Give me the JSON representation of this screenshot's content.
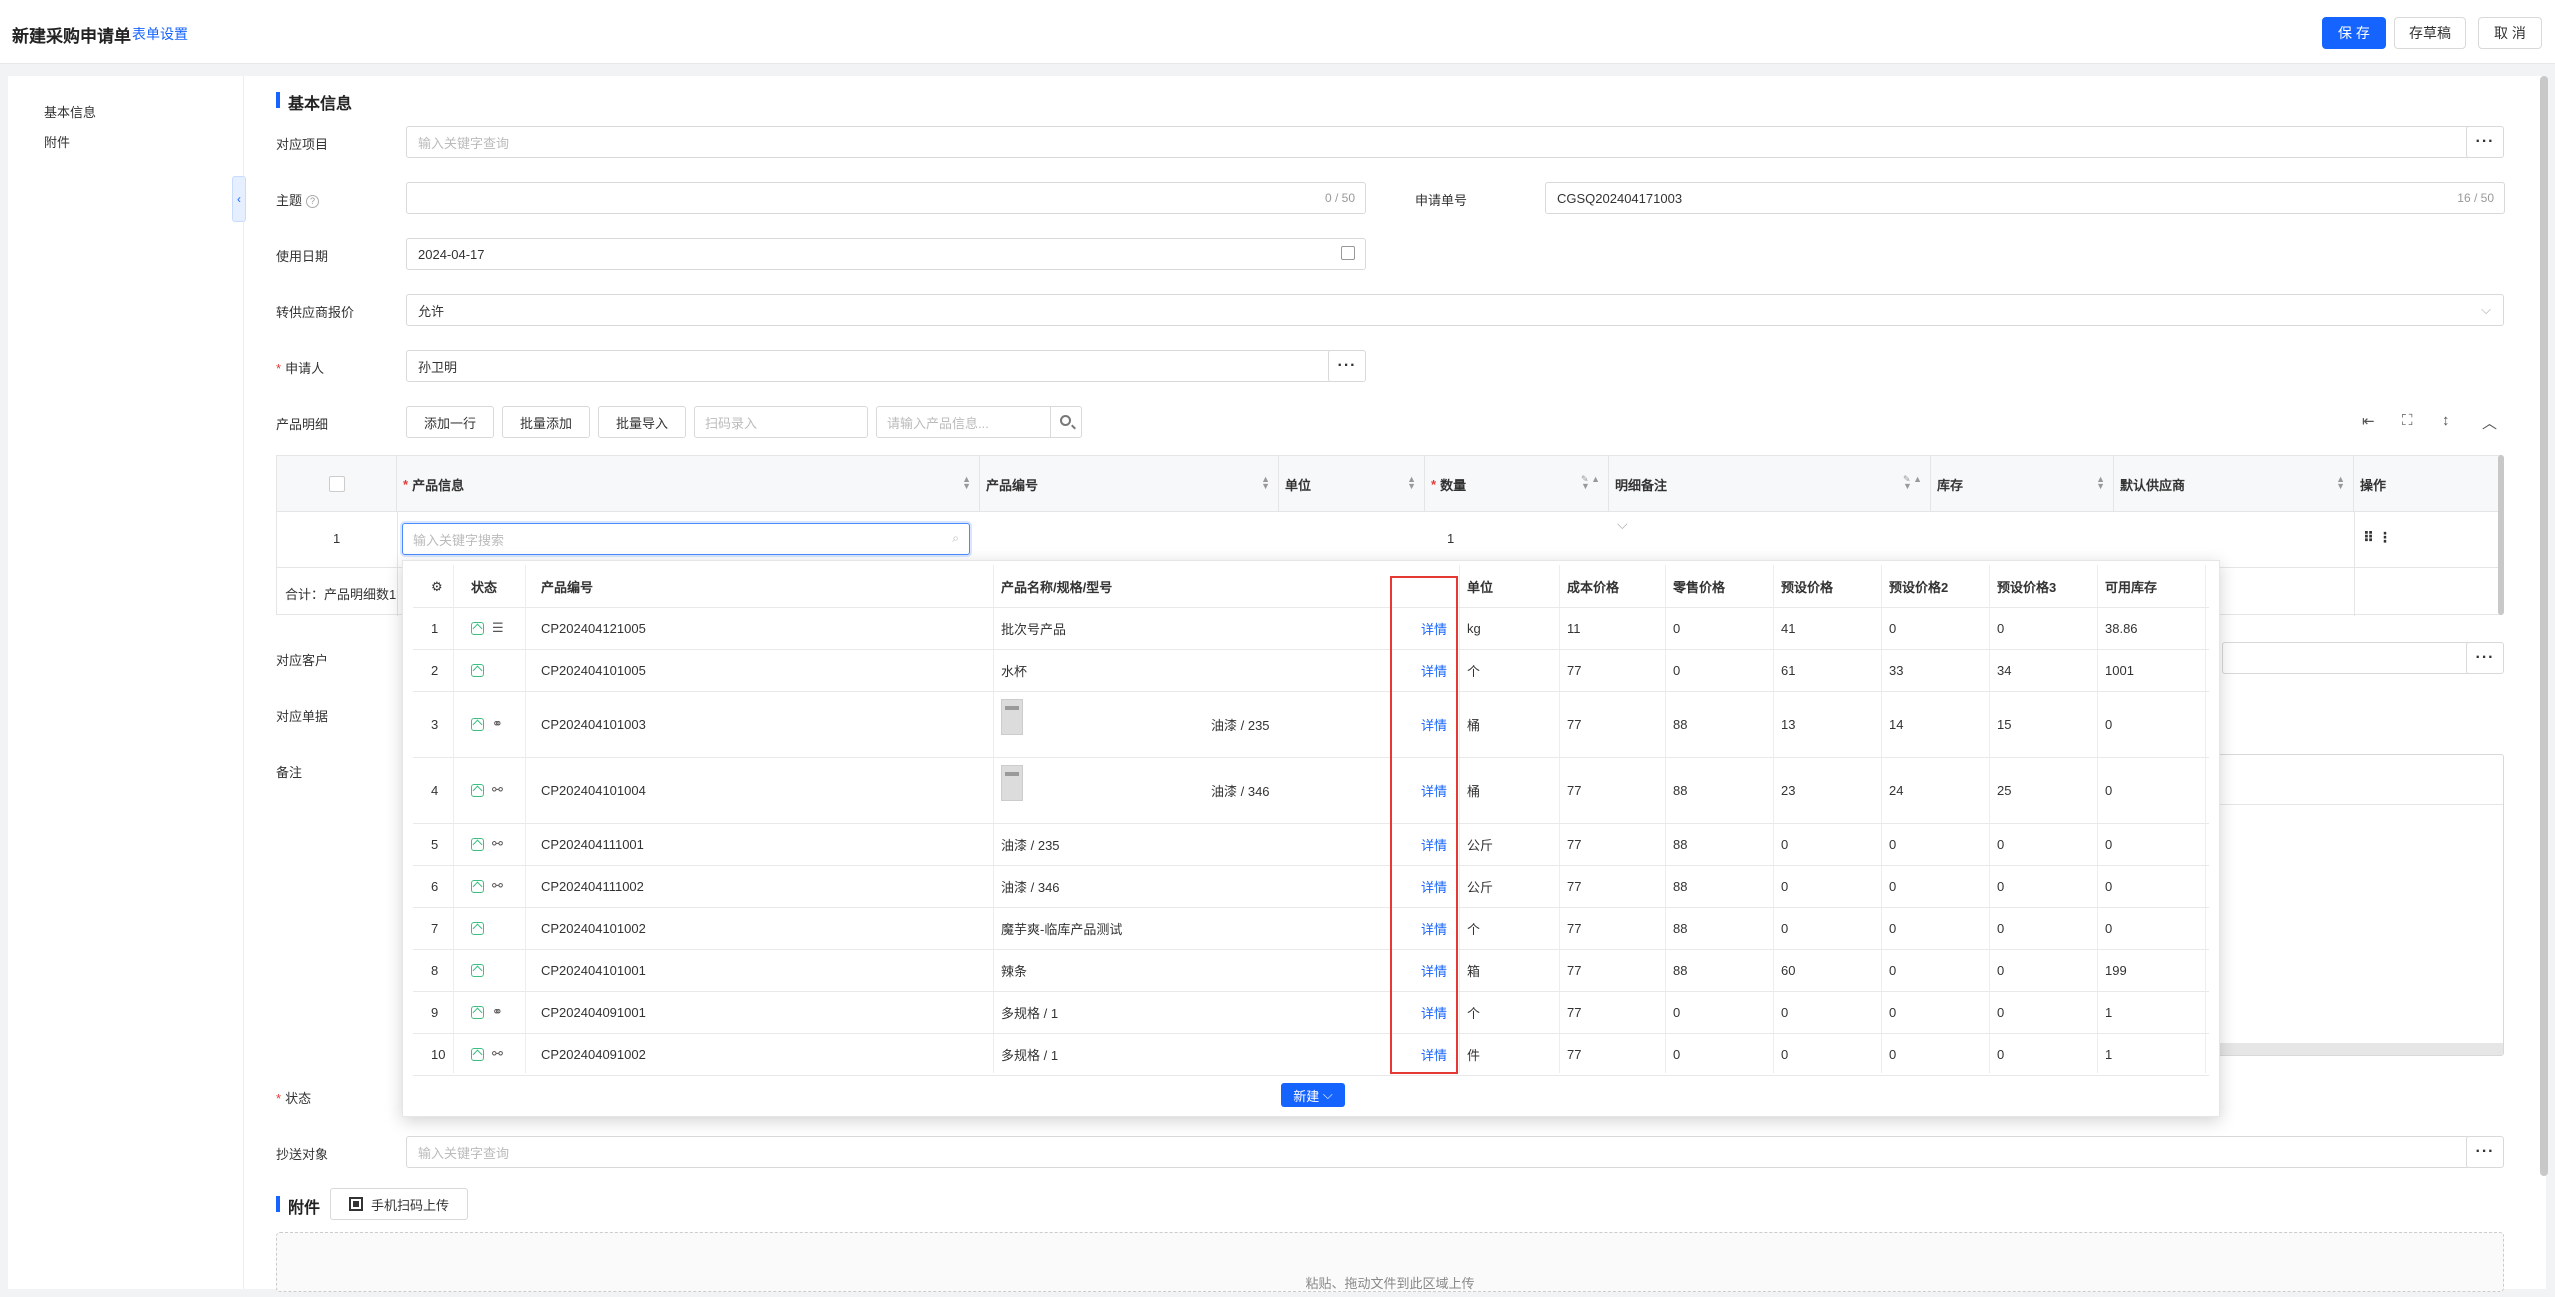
{
  "header": {
    "title": "新建采购申请单",
    "form_setting": "表单设置",
    "save": "保 存",
    "draft": "存草稿",
    "cancel": "取 消"
  },
  "nav": {
    "items": [
      "基本信息",
      "附件"
    ]
  },
  "basic": {
    "section_title": "基本信息",
    "project_label": "对应项目",
    "project_placeholder": "输入关键字查询",
    "subject_label": "主题",
    "subject_counter": "0 / 50",
    "apply_no_label": "申请单号",
    "apply_no_value": "CGSQ202404171003",
    "apply_no_counter": "16 / 50",
    "use_date_label": "使用日期",
    "use_date_value": "2024-04-17",
    "supplier_quote_label": "转供应商报价",
    "supplier_quote_value": "允许",
    "applicant_label": "申请人",
    "applicant_value": "孙卫明"
  },
  "product": {
    "label": "产品明细",
    "add_row": "添加一行",
    "batch_add": "批量添加",
    "batch_import": "批量导入",
    "scan_placeholder": "扫码录入",
    "search_placeholder": "请输入产品信息...",
    "columns": [
      "产品信息",
      "产品编号",
      "单位",
      "数量",
      "明细备注",
      "库存",
      "默认供应商",
      "操作"
    ],
    "row_index": "1",
    "row_qty": "1",
    "row_search_placeholder": "输入关键字搜索",
    "total_label": "合计：产品明细数1"
  },
  "other": {
    "customer_label": "对应客户",
    "document_label": "对应单据",
    "remark_label": "备注",
    "status_label": "状态",
    "cc_label": "抄送对象",
    "cc_placeholder": "输入关键字查询"
  },
  "attachment": {
    "section_title": "附件",
    "mobile_upload": "手机扫码上传",
    "drop_text": "粘贴、拖动文件到此区域上传"
  },
  "popup": {
    "columns": [
      "状态",
      "产品编号",
      "产品名称/规格/型号",
      "单位",
      "成本价格",
      "零售价格",
      "预设价格",
      "预设价格2",
      "预设价格3",
      "可用库存"
    ],
    "detail_label": "详情",
    "new_button": "新建",
    "rows": [
      {
        "idx": "1",
        "code": "CP202404121005",
        "name": "批次号产品",
        "spec": "",
        "unit": "kg",
        "cost": "11",
        "retail": "0",
        "p1": "41",
        "p2": "0",
        "p3": "0",
        "stock": "38.86",
        "icon2": "list",
        "thumb": false
      },
      {
        "idx": "2",
        "code": "CP202404101005",
        "name": "水杯",
        "spec": "",
        "unit": "个",
        "cost": "77",
        "retail": "0",
        "p1": "61",
        "p2": "33",
        "p3": "34",
        "stock": "1001",
        "icon2": "",
        "thumb": false
      },
      {
        "idx": "3",
        "code": "CP202404101003",
        "name": "",
        "spec": "油漆 / 235",
        "unit": "桶",
        "cost": "77",
        "retail": "88",
        "p1": "13",
        "p2": "14",
        "p3": "15",
        "stock": "0",
        "icon2": "multi",
        "thumb": true
      },
      {
        "idx": "4",
        "code": "CP202404101004",
        "name": "",
        "spec": "油漆 / 346",
        "unit": "桶",
        "cost": "77",
        "retail": "88",
        "p1": "23",
        "p2": "24",
        "p3": "25",
        "stock": "0",
        "icon2": "link",
        "thumb": true
      },
      {
        "idx": "5",
        "code": "CP202404111001",
        "name": "油漆 / 235",
        "spec": "",
        "unit": "公斤",
        "cost": "77",
        "retail": "88",
        "p1": "0",
        "p2": "0",
        "p3": "0",
        "stock": "0",
        "icon2": "link",
        "thumb": false
      },
      {
        "idx": "6",
        "code": "CP202404111002",
        "name": "油漆 / 346",
        "spec": "",
        "unit": "公斤",
        "cost": "77",
        "retail": "88",
        "p1": "0",
        "p2": "0",
        "p3": "0",
        "stock": "0",
        "icon2": "link",
        "thumb": false
      },
      {
        "idx": "7",
        "code": "CP202404101002",
        "name": "魔芋爽-临库产品测试",
        "spec": "",
        "unit": "个",
        "cost": "77",
        "retail": "88",
        "p1": "0",
        "p2": "0",
        "p3": "0",
        "stock": "0",
        "icon2": "",
        "thumb": false
      },
      {
        "idx": "8",
        "code": "CP202404101001",
        "name": "辣条",
        "spec": "",
        "unit": "箱",
        "cost": "77",
        "retail": "88",
        "p1": "60",
        "p2": "0",
        "p3": "0",
        "stock": "199",
        "icon2": "",
        "thumb": false
      },
      {
        "idx": "9",
        "code": "CP202404091001",
        "name": "多规格 / 1",
        "spec": "",
        "unit": "个",
        "cost": "77",
        "retail": "0",
        "p1": "0",
        "p2": "0",
        "p3": "0",
        "stock": "1",
        "icon2": "multi",
        "thumb": false
      },
      {
        "idx": "10",
        "code": "CP202404091002",
        "name": "多规格 / 1",
        "spec": "",
        "unit": "件",
        "cost": "77",
        "retail": "0",
        "p1": "0",
        "p2": "0",
        "p3": "0",
        "stock": "1",
        "icon2": "link",
        "thumb": false
      }
    ]
  },
  "colors": {
    "primary": "#1664ff",
    "status_green": "#3dbf82",
    "highlight_red": "#e53935"
  }
}
